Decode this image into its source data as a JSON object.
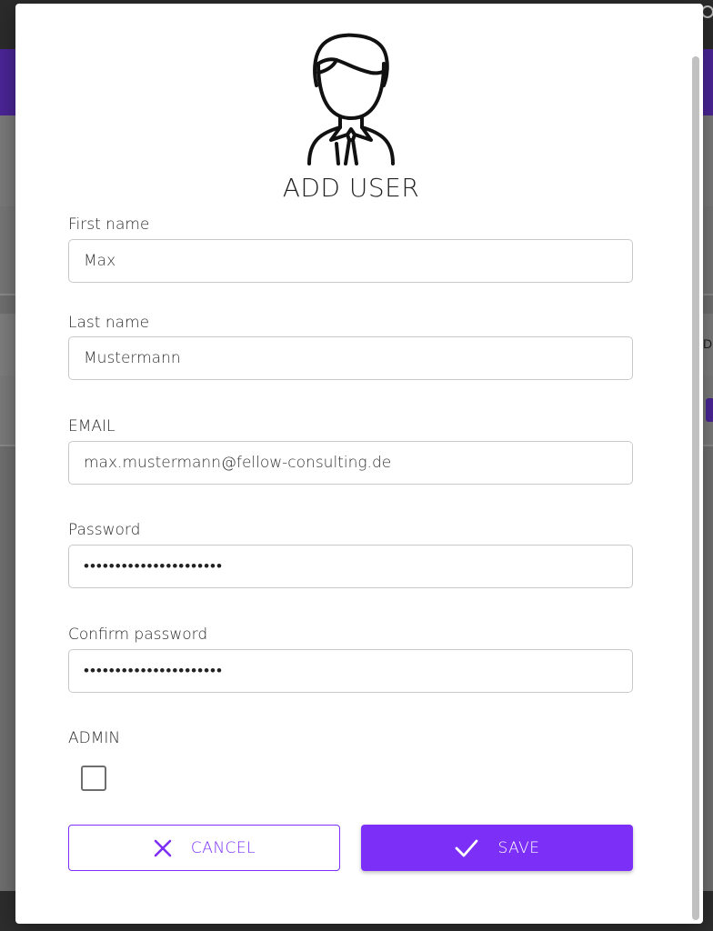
{
  "dialog": {
    "title": "ADD USER",
    "icon": "user-avatar-icon"
  },
  "form": {
    "first_name": {
      "label": "First name",
      "value": "Max"
    },
    "last_name": {
      "label": "Last name",
      "value": "Mustermann"
    },
    "email": {
      "label": "EMAIL",
      "value": "max.mustermann@fellow-consulting.de"
    },
    "password": {
      "label": "Password",
      "value": "••••••••••••••••••••••"
    },
    "confirm_password": {
      "label": "Confirm password",
      "value": "••••••••••••••••••••••"
    },
    "admin": {
      "label": "ADMIN",
      "checked": false
    }
  },
  "actions": {
    "cancel_label": "CANCEL",
    "save_label": "SAVE"
  },
  "background": {
    "edge_letter": "D"
  },
  "colors": {
    "accent": "#7b2ff7",
    "overlay_purple": "#4a2596"
  }
}
